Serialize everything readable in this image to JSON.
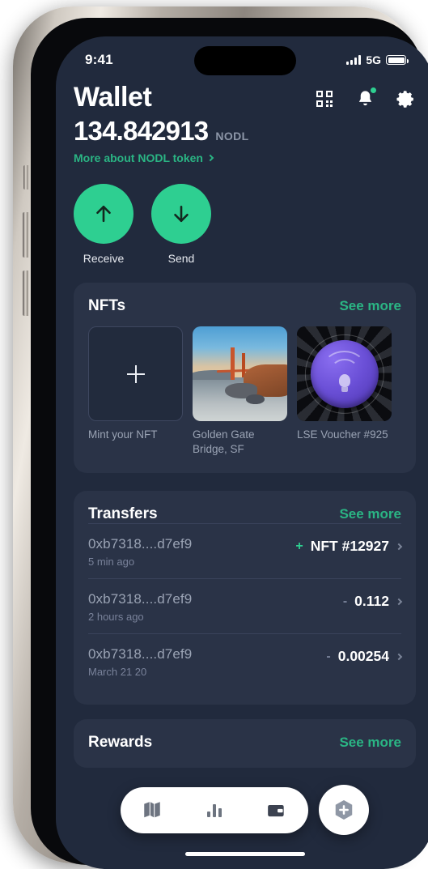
{
  "status_bar": {
    "time": "9:41",
    "network": "5G",
    "signal_icon": "signal-bars-icon",
    "battery_icon": "battery-icon"
  },
  "header": {
    "title": "Wallet",
    "icons": [
      {
        "name": "qr-scan-icon",
        "label": "Scan QR"
      },
      {
        "name": "bell-icon",
        "label": "Notifications",
        "has_badge": true
      },
      {
        "name": "gear-icon",
        "label": "Settings"
      }
    ]
  },
  "balance": {
    "amount": "134.842913",
    "unit": "NODL",
    "more_link": "More about NODL token"
  },
  "actions": [
    {
      "label": "Receive",
      "icon": "arrow-up-icon"
    },
    {
      "label": "Send",
      "icon": "arrow-down-icon"
    }
  ],
  "nfts": {
    "title": "NFTs",
    "see_more": "See more",
    "items": [
      {
        "caption": "Mint your NFT",
        "kind": "mint"
      },
      {
        "caption": "Golden Gate Bridge, SF",
        "kind": "image"
      },
      {
        "caption": "LSE Voucher #925",
        "kind": "image"
      }
    ]
  },
  "transfers": {
    "title": "Transfers",
    "see_more": "See more",
    "rows": [
      {
        "address": "0xb7318....d7ef9",
        "time": "5 min ago",
        "sign": "+",
        "amount": "NFT #12927"
      },
      {
        "address": "0xb7318....d7ef9",
        "time": "2 hours ago",
        "sign": "-",
        "amount": "0.112"
      },
      {
        "address": "0xb7318....d7ef9",
        "time": "March 21 20",
        "sign": "-",
        "amount": "0.00254"
      }
    ]
  },
  "rewards": {
    "title": "Rewards",
    "see_more": "See more"
  },
  "bottom_nav": {
    "items": [
      {
        "name": "map-icon",
        "label": "Map"
      },
      {
        "name": "bar-chart-icon",
        "label": "Stats"
      },
      {
        "name": "wallet-icon",
        "label": "Wallet"
      }
    ],
    "fab": {
      "name": "hexagon-plus-icon",
      "label": "Add"
    }
  },
  "colors": {
    "accent_green": "#2ecf91",
    "link_green": "#2ab584",
    "page_bg": "#212a3d",
    "card_bg": "#2a3347"
  }
}
